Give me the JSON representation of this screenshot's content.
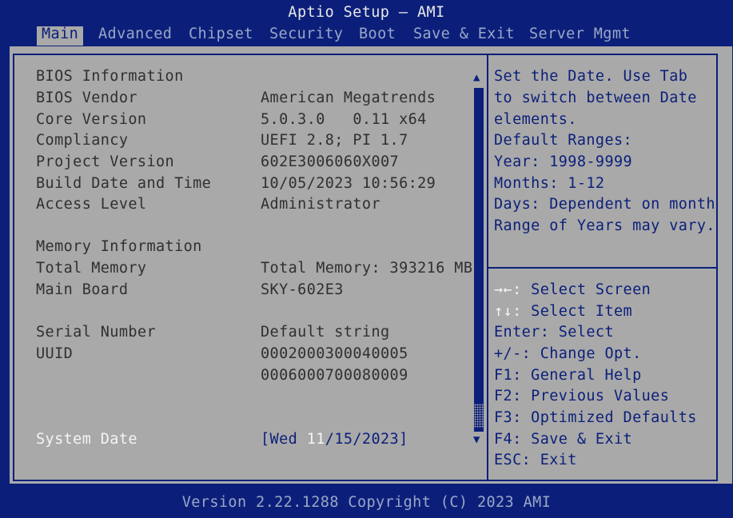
{
  "window": {
    "title": "Aptio Setup – AMI"
  },
  "tabs": [
    {
      "label": "Main",
      "active": true
    },
    {
      "label": "Advanced"
    },
    {
      "label": "Chipset"
    },
    {
      "label": "Security"
    },
    {
      "label": "Boot"
    },
    {
      "label": "Save & Exit"
    },
    {
      "label": "Server Mgmt"
    }
  ],
  "main": {
    "bios_section": "BIOS Information",
    "rows": [
      {
        "label": "BIOS Vendor",
        "value": "American Megatrends"
      },
      {
        "label": "Core Version",
        "value": "5.0.3.0   0.11 x64"
      },
      {
        "label": "Compliancy",
        "value": "UEFI 2.8; PI 1.7"
      },
      {
        "label": "Project Version",
        "value": "602E3006060X007"
      },
      {
        "label": "Build Date and Time",
        "value": "10/05/2023 10:56:29"
      },
      {
        "label": "Access Level",
        "value": "Administrator"
      }
    ],
    "memory_section": "Memory Information",
    "memory_rows": [
      {
        "label": "Total Memory",
        "value": "Total Memory: 393216 MB"
      },
      {
        "label": "Main Board",
        "value": "SKY-602E3"
      }
    ],
    "serial_label": "Serial Number",
    "serial_value": "Default string",
    "uuid_label": "UUID",
    "uuid_line1": "0002000300040005",
    "uuid_line2": "0006000700080009",
    "system_date_label": "System Date",
    "system_date_prefix": "[Wed ",
    "system_date_month": "11",
    "system_date_rest": "/15/2023]"
  },
  "help": {
    "description": [
      "Set the Date. Use Tab",
      "to switch between Date",
      "elements.",
      "Default Ranges:",
      "Year: 1998-9999",
      "Months: 1-12",
      "Days: Dependent on month",
      "Range of Years may vary."
    ],
    "keys": [
      {
        "key": "→←:",
        "desc": " Select Screen"
      },
      {
        "key": "↑↓:",
        "desc": " Select Item"
      },
      {
        "key": "Enter:",
        "desc": " Select"
      },
      {
        "key": "+/-:",
        "desc": " Change Opt."
      },
      {
        "key": "F1:",
        "desc": " General Help"
      },
      {
        "key": "F2:",
        "desc": " Previous Values"
      },
      {
        "key": "F3:",
        "desc": " Optimized Defaults"
      },
      {
        "key": "F4:",
        "desc": " Save & Exit"
      },
      {
        "key": "ESC:",
        "desc": " Exit"
      }
    ]
  },
  "scroll": {
    "up_arrow": "▲",
    "down_arrow": "▼"
  },
  "footer": {
    "text": "Version 2.22.1288 Copyright (C) 2023 AMI"
  }
}
